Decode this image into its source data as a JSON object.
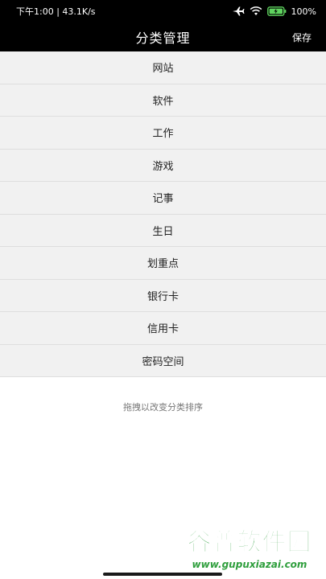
{
  "status_bar": {
    "time_speed": "下午1:00 | 43.1K/s",
    "battery": "100%",
    "icons": [
      "airplane-icon",
      "wifi-icon",
      "battery-icon"
    ]
  },
  "header": {
    "title": "分类管理",
    "save_label": "保存"
  },
  "categories": [
    {
      "label": "网站"
    },
    {
      "label": "软件"
    },
    {
      "label": "工作"
    },
    {
      "label": "游戏"
    },
    {
      "label": "记事"
    },
    {
      "label": "生日"
    },
    {
      "label": "划重点"
    },
    {
      "label": "银行卡"
    },
    {
      "label": "信用卡"
    },
    {
      "label": "密码空间"
    }
  ],
  "hint": "拖拽以改变分类排序",
  "watermark": {
    "brand": "谷普软件园",
    "url": "www.gupuxiazai.com"
  },
  "colors": {
    "header_bg": "#000000",
    "item_bg": "#f1f1f1",
    "divider": "#dedede",
    "watermark": "#2e9e3c"
  }
}
